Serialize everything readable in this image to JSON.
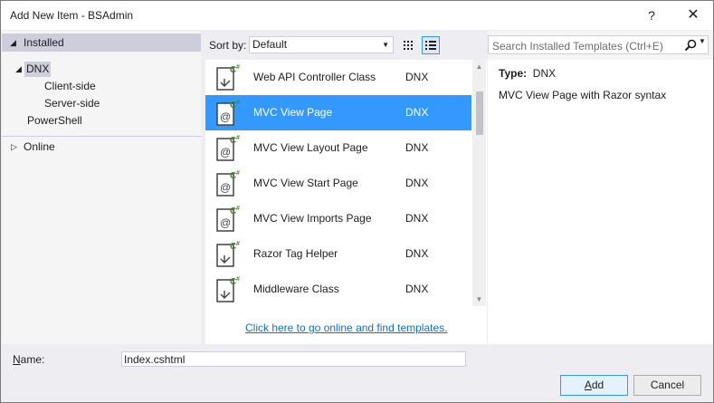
{
  "window": {
    "title": "Add New Item - BSAdmin",
    "help": "?",
    "close": "✕"
  },
  "tree": {
    "installed": "Installed",
    "dnx": "DNX",
    "client_side": "Client-side",
    "server_side": "Server-side",
    "powershell": "PowerShell",
    "online": "Online"
  },
  "toolbar": {
    "sort_label": "Sort by:",
    "sort_value": "Default"
  },
  "items": [
    {
      "name": "Web API Controller Class",
      "lang": "DNX",
      "icon": "cs-class-icon"
    },
    {
      "name": "MVC View Page",
      "lang": "DNX",
      "icon": "razor-page-icon"
    },
    {
      "name": "MVC View Layout Page",
      "lang": "DNX",
      "icon": "razor-page-icon"
    },
    {
      "name": "MVC View Start Page",
      "lang": "DNX",
      "icon": "razor-page-icon"
    },
    {
      "name": "MVC View Imports Page",
      "lang": "DNX",
      "icon": "razor-page-icon"
    },
    {
      "name": "Razor Tag Helper",
      "lang": "DNX",
      "icon": "cs-class-icon"
    },
    {
      "name": "Middleware Class",
      "lang": "DNX",
      "icon": "cs-class-icon"
    }
  ],
  "online_link": "Click here to go online and find templates.",
  "search": {
    "placeholder": "Search Installed Templates (Ctrl+E)"
  },
  "details": {
    "type_label": "Type:",
    "type_value": "DNX",
    "description": "MVC View Page with Razor syntax"
  },
  "footer": {
    "name_label": "Name:",
    "name_value": "Index.cshtml",
    "add_label_underlined": "A",
    "add_label_rest": "dd",
    "cancel_label": "Cancel"
  },
  "colors": {
    "accent": "#3399ff",
    "link": "#0e70c0",
    "cs_green": "#3c8a1f"
  }
}
